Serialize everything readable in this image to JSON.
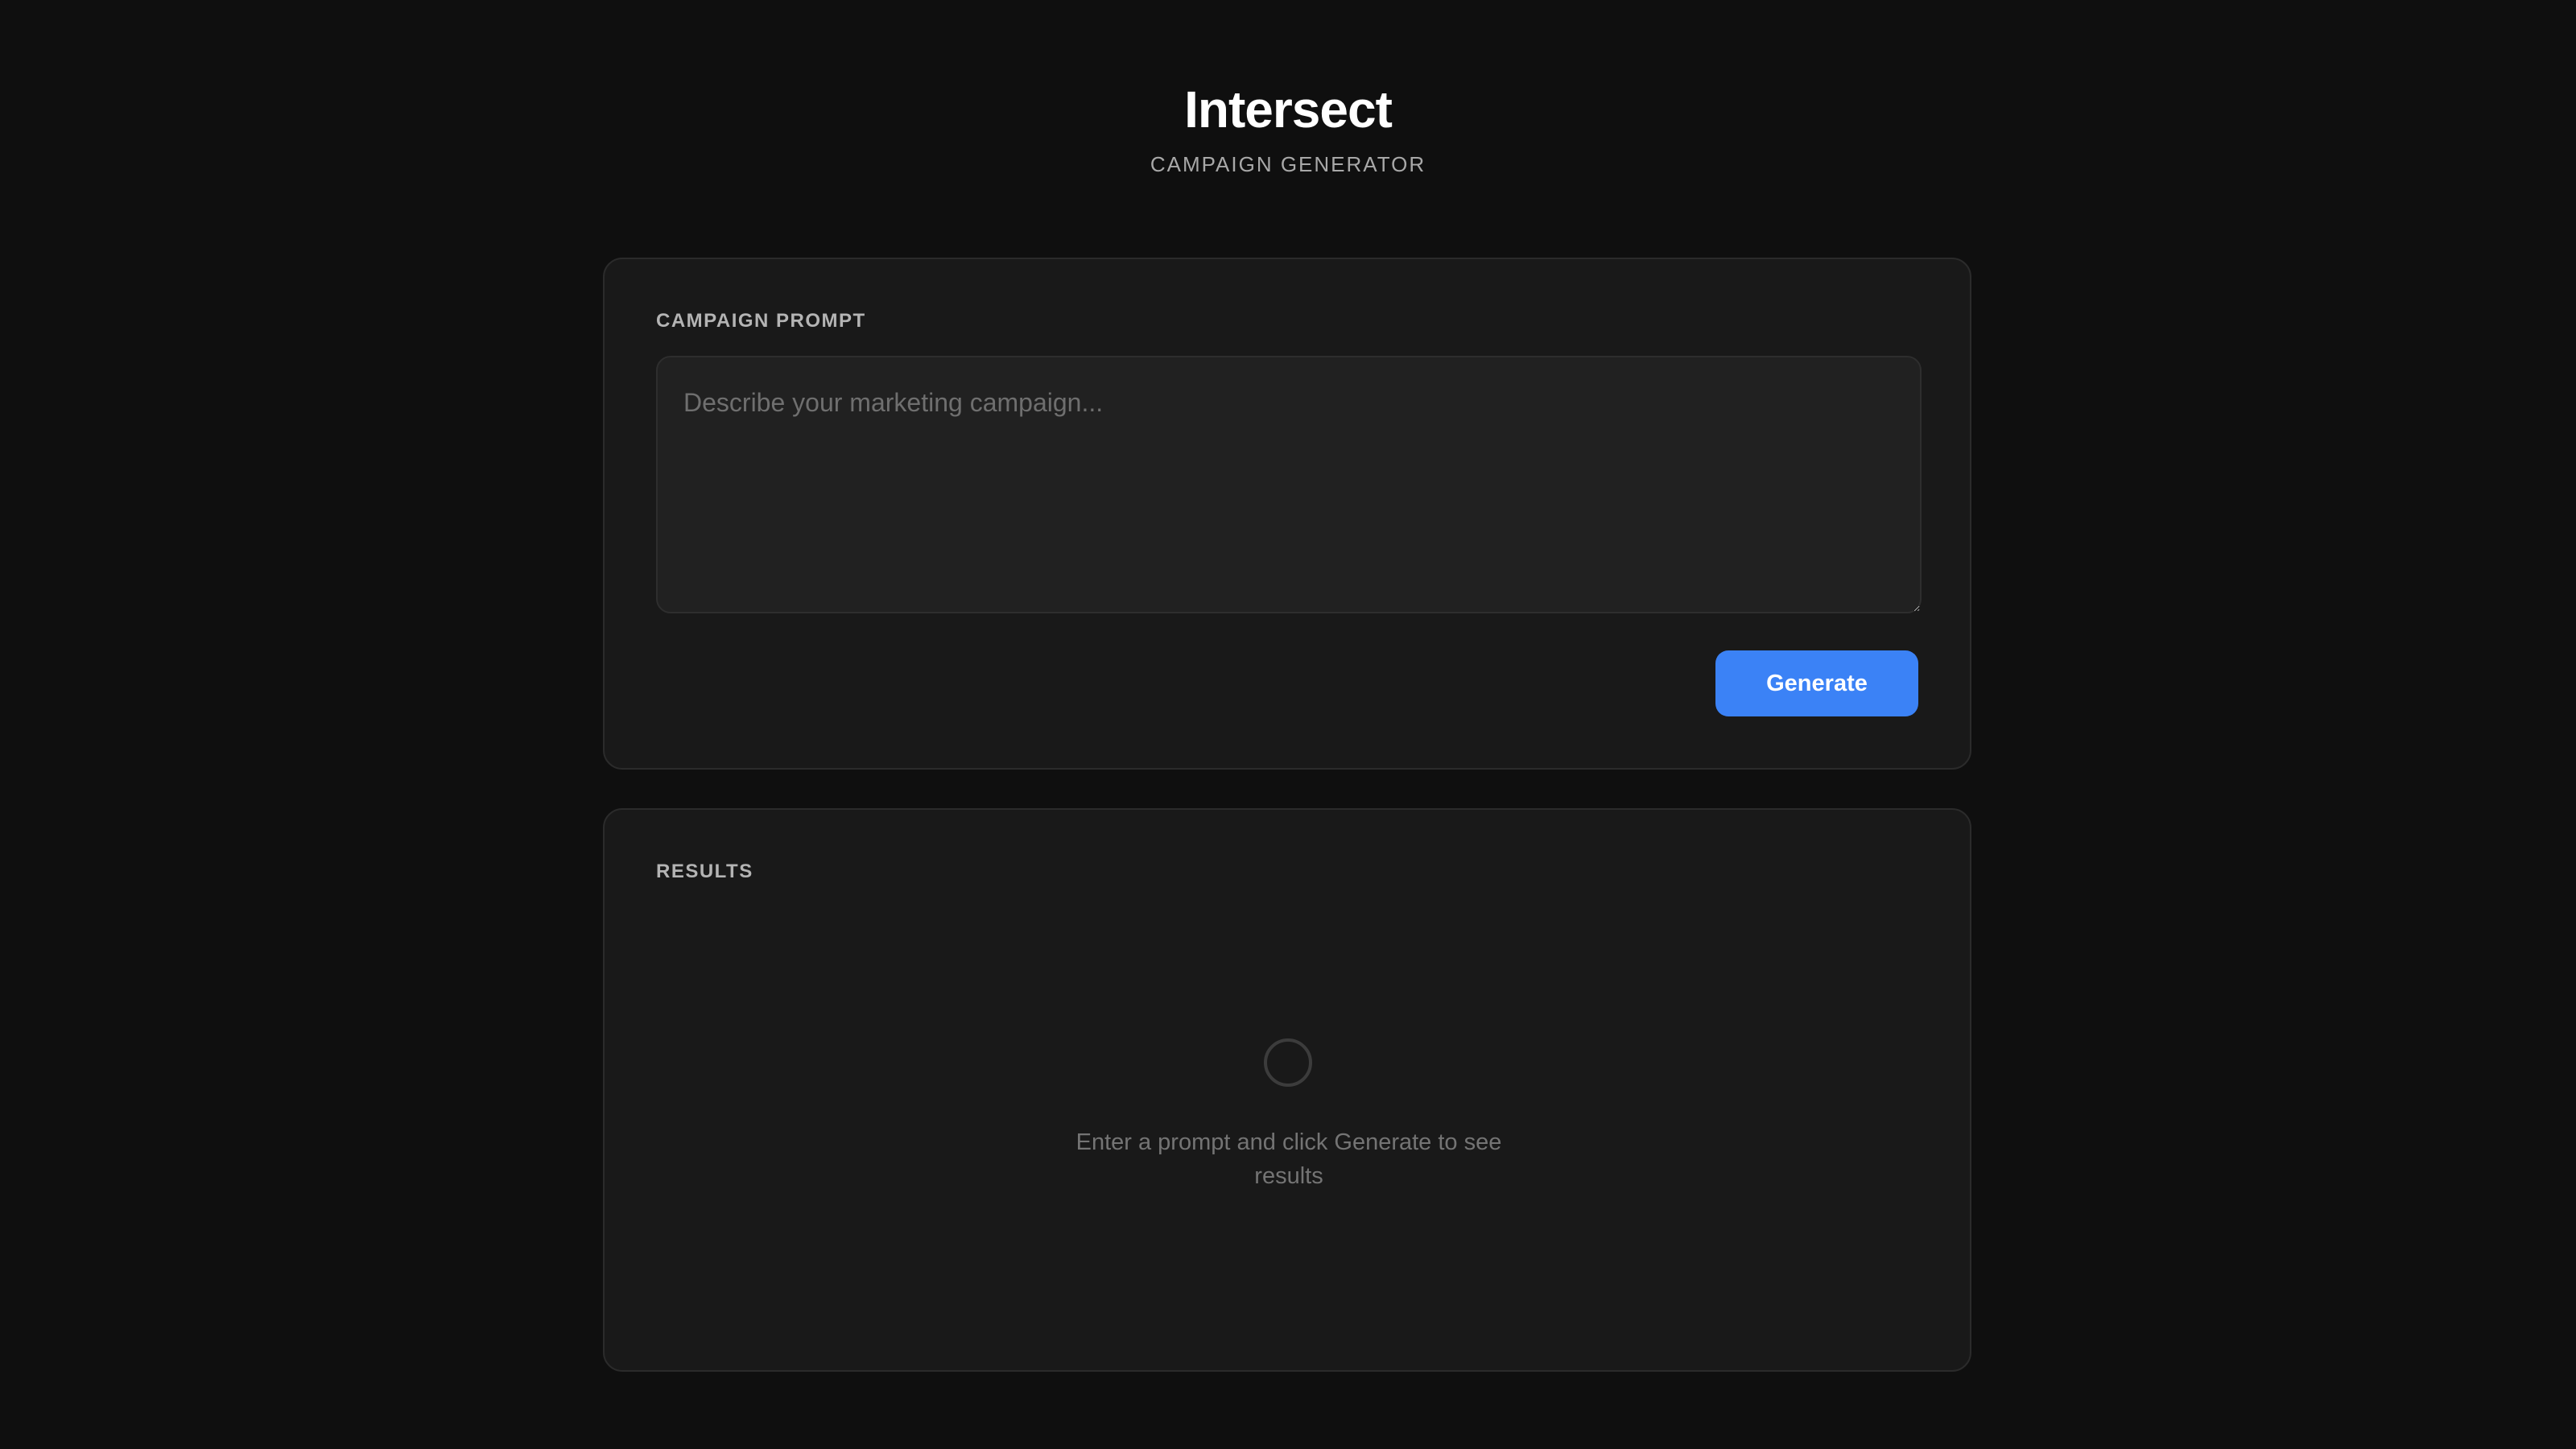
{
  "header": {
    "title": "Intersect",
    "subtitle": "CAMPAIGN GENERATOR"
  },
  "prompt_section": {
    "label": "CAMPAIGN PROMPT",
    "input_value": "",
    "input_placeholder": "Describe your marketing campaign...",
    "generate_label": "Generate"
  },
  "results_section": {
    "label": "RESULTS",
    "empty_icon": "spinner-ring-icon",
    "empty_message": "Enter a prompt and click Generate to see results"
  },
  "colors": {
    "background": "#0f0f0f",
    "card": "#191919",
    "accent": "#3b82f6"
  }
}
